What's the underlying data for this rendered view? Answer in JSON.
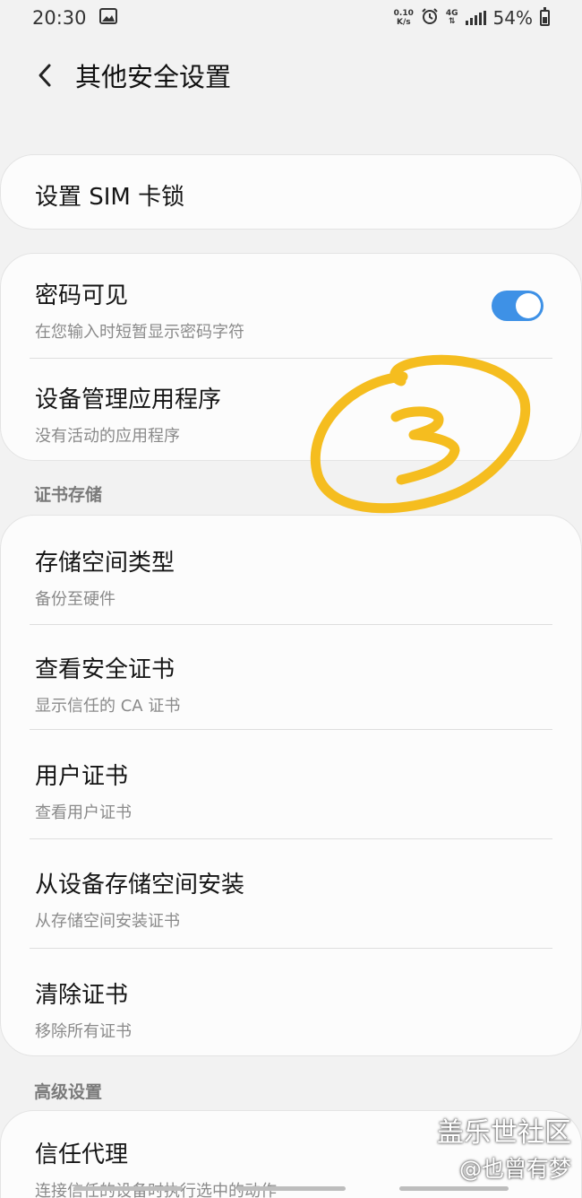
{
  "status_bar": {
    "time": "20:30",
    "net_speed_value": "0.10",
    "net_speed_unit": "K/s",
    "network": "4G",
    "battery": "54%"
  },
  "header": {
    "title": "其他安全设置"
  },
  "sim_lock": {
    "title": "设置 SIM 卡锁"
  },
  "password_visible": {
    "title": "密码可见",
    "subtitle": "在您输入时短暂显示密码字符",
    "enabled": true,
    "toggle_color": "#3e91e6"
  },
  "device_admin": {
    "title": "设备管理应用程序",
    "subtitle": "没有活动的应用程序"
  },
  "cert_section": {
    "label": "证书存储",
    "items": [
      {
        "title": "存储空间类型",
        "subtitle": "备份至硬件"
      },
      {
        "title": "查看安全证书",
        "subtitle": "显示信任的 CA 证书"
      },
      {
        "title": "用户证书",
        "subtitle": "查看用户证书"
      },
      {
        "title": "从设备存储空间安装",
        "subtitle": "从存储空间安装证书"
      },
      {
        "title": "清除证书",
        "subtitle": "移除所有证书"
      }
    ]
  },
  "advanced_section": {
    "label": "高级设置",
    "items": [
      {
        "title": "信任代理",
        "subtitle": "连接信任的设备时执行选中的动作"
      }
    ]
  },
  "watermark": {
    "line1": "盖乐世社区",
    "line2": "@也曾有梦"
  },
  "annotation_color": "#f5bd1f"
}
